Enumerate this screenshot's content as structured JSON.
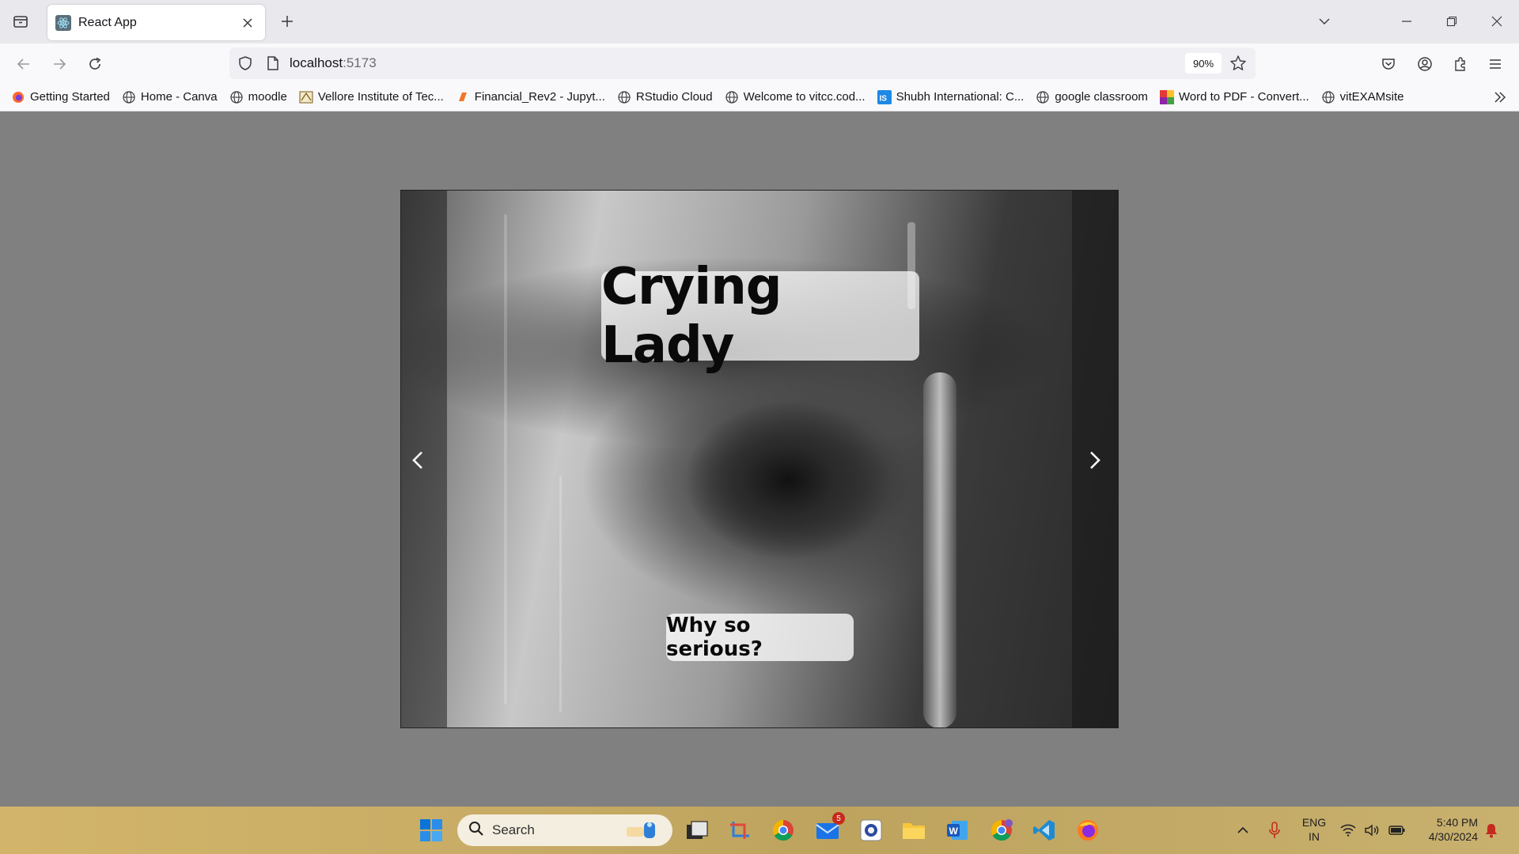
{
  "browser": {
    "tab": {
      "title": "React App",
      "favicon": "react-icon"
    },
    "url": {
      "host": "localhost",
      "port": ":5173"
    },
    "zoom": "90%",
    "bookmarks": [
      {
        "label": "Getting Started",
        "icon": "firefox-icon"
      },
      {
        "label": "Home - Canva",
        "icon": "globe-icon"
      },
      {
        "label": "moodle",
        "icon": "globe-icon"
      },
      {
        "label": "Vellore Institute of Tec...",
        "icon": "vit-logo-icon"
      },
      {
        "label": "Financial_Rev2 - Jupyt...",
        "icon": "jupyter-icon"
      },
      {
        "label": "RStudio Cloud",
        "icon": "globe-icon"
      },
      {
        "label": "Welcome to vitcc.cod...",
        "icon": "globe-icon"
      },
      {
        "label": "Shubh International: C...",
        "icon": "is-logo-icon"
      },
      {
        "label": "google classroom",
        "icon": "globe-icon"
      },
      {
        "label": "Word to PDF - Convert...",
        "icon": "colorful-grid-icon"
      },
      {
        "label": "vitEXAMsite",
        "icon": "globe-icon"
      }
    ]
  },
  "slide": {
    "title": "Crying Lady",
    "caption": "Why so serious?"
  },
  "taskbar": {
    "search_label": "Search",
    "mail_badge": "5",
    "language": {
      "line1": "ENG",
      "line2": "IN"
    },
    "time": "5:40 PM",
    "date": "4/30/2024"
  },
  "colors": {
    "page_background": "#808080",
    "accent_windows": "#0078d4"
  }
}
